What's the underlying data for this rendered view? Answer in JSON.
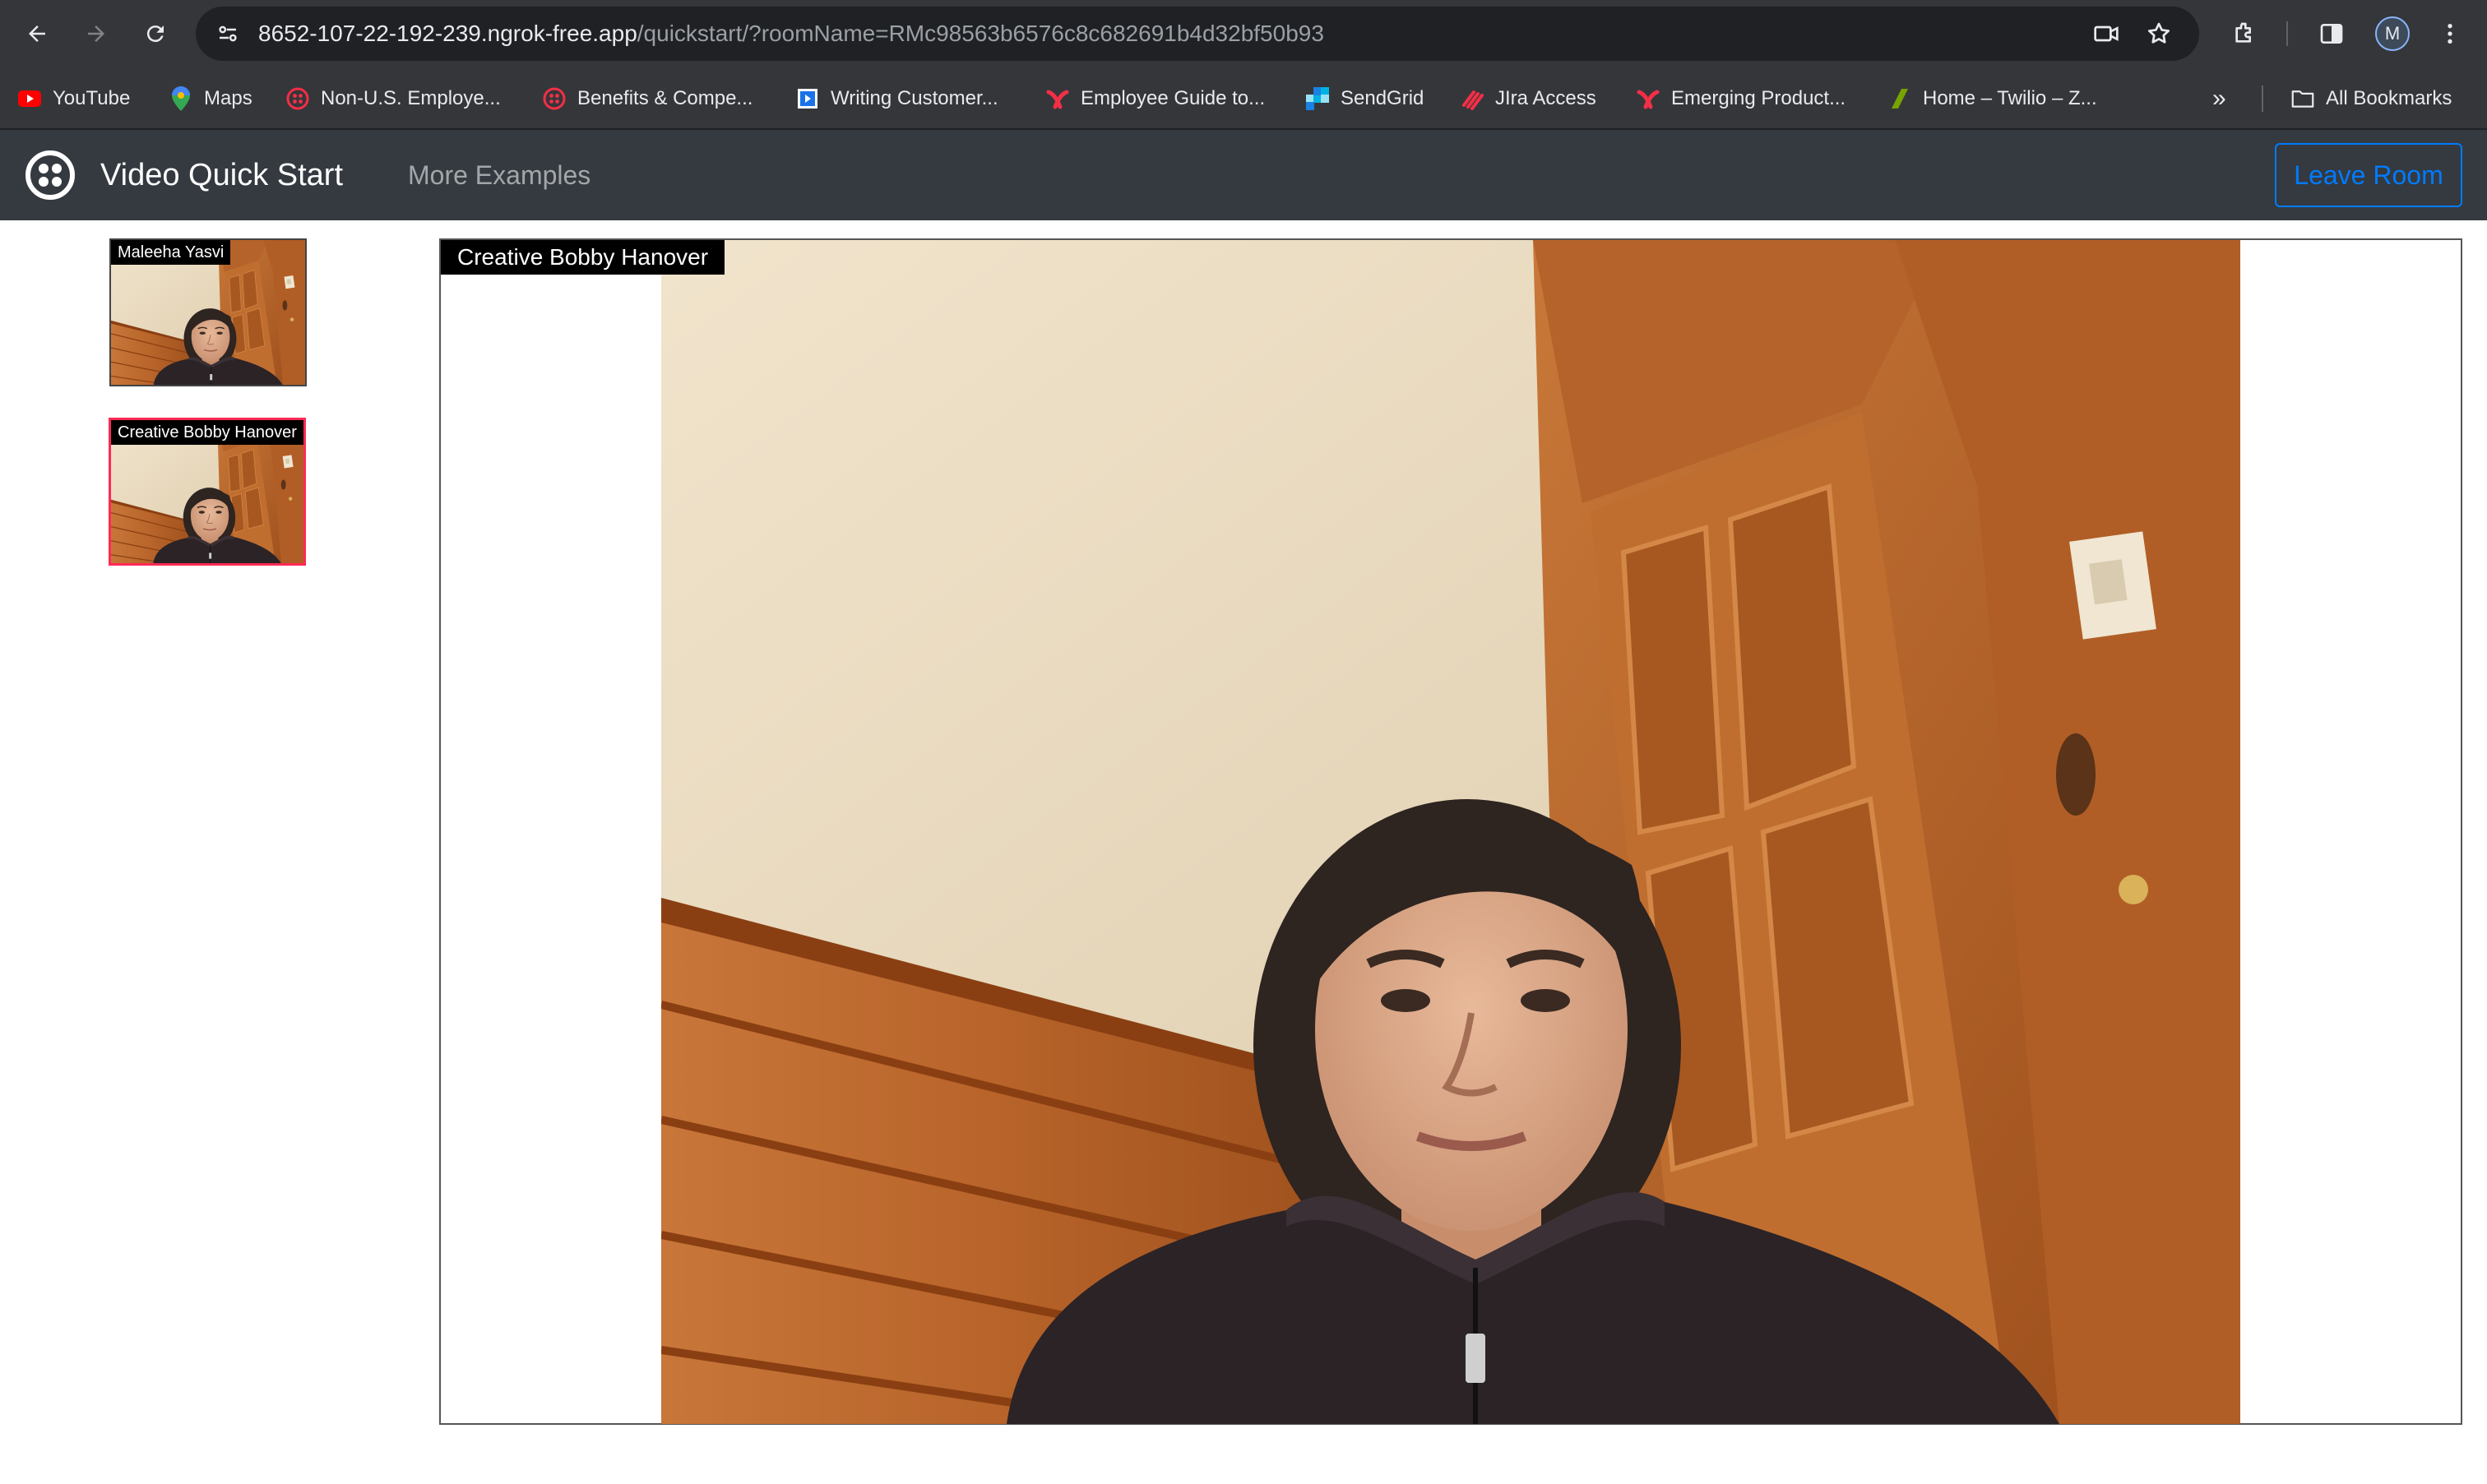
{
  "browser": {
    "url_host": "8652-107-22-192-239.ngrok-free.app",
    "url_path": "/quickstart/?roomName=RMc98563b6576c8c682691b4d32bf50b93",
    "profile_initial": "M",
    "bookmarks": [
      {
        "label": "YouTube",
        "icon": "youtube-icon",
        "color": "#ff0000"
      },
      {
        "label": "Maps",
        "icon": "maps-icon",
        "color": "#34a853"
      },
      {
        "label": "Non-U.S. Employe...",
        "icon": "twilio-icon",
        "color": "#f22f46"
      },
      {
        "label": "Benefits & Compe...",
        "icon": "twilio-icon",
        "color": "#f22f46"
      },
      {
        "label": "Writing Customer...",
        "icon": "video-doc-icon",
        "color": "#1a73e8"
      },
      {
        "label": "Employee Guide to...",
        "icon": "confluence-x-icon",
        "color": "#f22f46"
      },
      {
        "label": "SendGrid",
        "icon": "sendgrid-icon",
        "color": "#1a82e2"
      },
      {
        "label": "JIra Access",
        "icon": "jira-icon",
        "color": "#f22f46"
      },
      {
        "label": "Emerging Product...",
        "icon": "confluence-x-icon",
        "color": "#f22f46"
      },
      {
        "label": "Home – Twilio – Z...",
        "icon": "zendesk-icon",
        "color": "#78a300"
      }
    ],
    "all_bookmarks_label": "All Bookmarks"
  },
  "app": {
    "brand_title": "Video Quick Start",
    "nav_link": "More Examples",
    "leave_button": "Leave Room",
    "accent_color": "#007bff",
    "active_border_color": "#ff2a55"
  },
  "participants": [
    {
      "name": "Maleeha Yasvi",
      "active": false
    },
    {
      "name": "Creative Bobby Hanover",
      "active": true
    }
  ],
  "main_video": {
    "label": "Creative Bobby Hanover"
  }
}
